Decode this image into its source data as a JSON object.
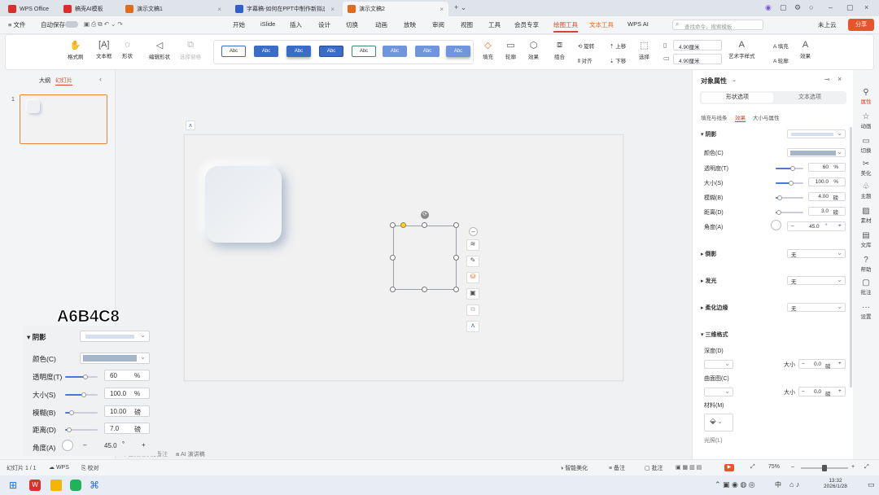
{
  "tabs": [
    {
      "label": "WPS Office",
      "color": "#d9302b"
    },
    {
      "label": "稿壳AI模板",
      "color": "#d9302b"
    },
    {
      "label": "演示文稿1",
      "color": "#e36b1b"
    },
    {
      "label": "字幕稿-如何在PPT中制作新拟态",
      "color": "#2f5fd0"
    },
    {
      "label": "演示文稿2",
      "color": "#e36b1b"
    }
  ],
  "tabbar": {
    "new_tab": "+ ⌄",
    "avatar": "○"
  },
  "menubar": {
    "file": "≡ 文件",
    "autosave": "自动保存",
    "items": [
      "开始",
      "iSlide",
      "插入",
      "设计",
      "切换",
      "动画",
      "放映",
      "审阅",
      "视图",
      "工具",
      "会员专享",
      "绘图工具",
      "文本工具",
      "WPS AI"
    ],
    "active": "绘图工具",
    "search_placeholder": "查找命令、搜索模板",
    "cloud": "未上云",
    "share": "分享"
  },
  "ribbon": {
    "buttons": [
      "格式刷",
      "文本框",
      "形状",
      "编辑形状",
      "选择窗格"
    ],
    "style_label": "Abc",
    "fill": "填充",
    "outline": "轮廓",
    "effect": "效果",
    "group": "组合",
    "rotate": "旋转",
    "align": "对齐",
    "up": "上移",
    "down": "下移",
    "select": "选择",
    "height": "4.90厘米",
    "width": "4.90厘米",
    "art": "艺术字样式",
    "fill2": "填充",
    "outline2": "轮廓",
    "effect2": "效果"
  },
  "leftpane": {
    "tab_outline": "大纲",
    "tab_slides": "幻灯片",
    "slide_number": "1"
  },
  "canvas": {
    "notes_placeholder": "单击此处添加备注",
    "ai_notes": "AI 演讲稿"
  },
  "panel": {
    "title": "对象属性",
    "tab_shape": "形状选项",
    "tab_text": "文本选项",
    "subtabs": [
      "填充与线条",
      "效果",
      "大小与属性"
    ],
    "active_subtab": "效果",
    "shadow": "阴影",
    "color": "颜色(C)",
    "transparency": "透明度(T)",
    "transparency_val": "60",
    "transparency_unit": "%",
    "size": "大小(S)",
    "size_val": "100.0",
    "size_unit": "%",
    "blur": "模糊(B)",
    "blur_val": "4.00",
    "blur_unit": "磅",
    "distance": "距离(D)",
    "distance_val": "3.0",
    "distance_unit": "磅",
    "angle": "角度(A)",
    "angle_val": "45.0",
    "angle_unit": "°",
    "reflection": "倒影",
    "glow": "发光",
    "soft_edge": "柔化边缘",
    "none": "无",
    "three_d": "三维格式",
    "depth": "深度(D)",
    "contour": "曲面图(C)",
    "size2": "大小",
    "size2_val": "0.0",
    "size2_unit": "磅",
    "material": "材料(M)",
    "lighting": "光照(L)",
    "color_swatch": "#a6b4c8"
  },
  "rside": [
    "属性",
    "动画",
    "切换",
    "美化",
    "主题",
    "素材",
    "文库",
    "帮助",
    "批注",
    "设置"
  ],
  "status": {
    "slide": "幻灯片 1 / 1",
    "wps": "WPS",
    "proof": "校对",
    "smart": "智能美化",
    "notes": "备注",
    "comments": "批注",
    "zoom": "75%"
  },
  "taskbar": {
    "lang": "中",
    "time": "13:32",
    "date": "2026/1/28"
  },
  "overlay": {
    "hex": "A6B4C8",
    "shadow": "阴影",
    "color": "颜色(C)",
    "transparency": "透明度(T)",
    "transparency_val": "60",
    "transparency_unit": "%",
    "size": "大小(S)",
    "size_val": "100.0",
    "size_unit": "%",
    "blur": "模糊(B)",
    "blur_val": "10.00",
    "blur_unit": "磅",
    "distance": "距离(D)",
    "distance_val": "7.0",
    "distance_unit": "磅",
    "angle": "角度(A)",
    "angle_val": "45.0",
    "angle_unit": "°"
  }
}
